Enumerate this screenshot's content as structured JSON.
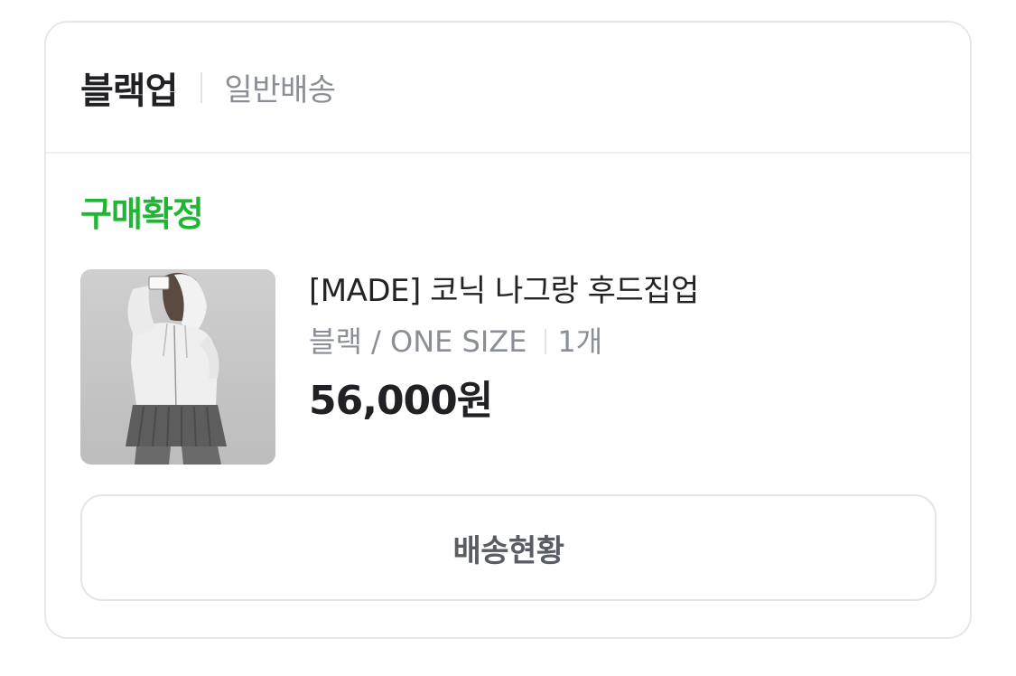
{
  "header": {
    "store_name": "블랙업",
    "shipping_type": "일반배송"
  },
  "order": {
    "status": "구매확정",
    "status_color": "#1fb633"
  },
  "product": {
    "name": "[MADE] 코닉 나그랑 후드집업",
    "option": "블랙 / ONE SIZE",
    "quantity": "1개",
    "price": "56,000원",
    "thumbnail": "product-photo"
  },
  "actions": {
    "track_label": "배송현황"
  }
}
